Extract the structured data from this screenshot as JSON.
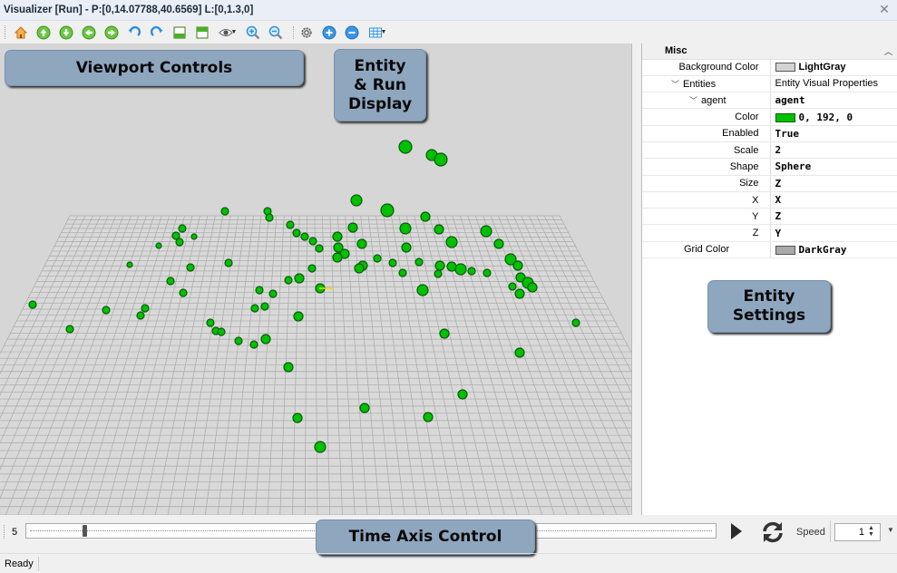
{
  "window": {
    "title": "Visualizer [Run]  - P:[0,14.07788,40.6569] L:[0,1.3,0]"
  },
  "toolbar": {
    "buttons": [
      {
        "name": "home-icon",
        "color": "#d7791a"
      },
      {
        "name": "pan-up-icon",
        "color": "#4caf2a"
      },
      {
        "name": "pan-down-icon",
        "color": "#4caf2a"
      },
      {
        "name": "pan-left-icon",
        "color": "#4caf2a"
      },
      {
        "name": "pan-right-icon",
        "color": "#4caf2a"
      },
      {
        "name": "rotate-left-icon",
        "color": "#2c8fe0"
      },
      {
        "name": "rotate-right-icon",
        "color": "#2c8fe0"
      },
      {
        "name": "view-bottom-icon",
        "color": "#4caf2a"
      },
      {
        "name": "view-top-icon",
        "color": "#4caf2a"
      },
      {
        "name": "eye-icon",
        "color": "#555555"
      },
      {
        "name": "zoom-in-icon",
        "color": "#2c8fe0"
      },
      {
        "name": "zoom-out-icon",
        "color": "#2c8fe0"
      },
      {
        "name": "settings-icon",
        "color": "#555555"
      },
      {
        "name": "add-icon",
        "color": "#2c8fe0"
      },
      {
        "name": "remove-icon",
        "color": "#2c8fe0"
      },
      {
        "name": "grid-icon",
        "color": "#2c8fe0"
      }
    ]
  },
  "callouts": {
    "viewport_controls": "Viewport Controls",
    "entity_run_display_1": "Entity",
    "entity_run_display_2": "& Run",
    "entity_run_display_3": "Display",
    "entity_settings_1": "Entity",
    "entity_settings_2": "Settings",
    "time_axis_control": "Time Axis Control"
  },
  "properties": {
    "category": "Misc",
    "background_color": {
      "name": "Background Color",
      "value": "LightGray",
      "swatch": "#d3d3d3"
    },
    "entities": {
      "name": "Entities",
      "value": "Entity Visual Properties"
    },
    "agent": {
      "name": "agent",
      "value": "agent"
    },
    "color": {
      "name": "Color",
      "value": "0, 192, 0",
      "swatch": "#00c000"
    },
    "enabled": {
      "name": "Enabled",
      "value": "True"
    },
    "scale": {
      "name": "Scale",
      "value": "2"
    },
    "shape": {
      "name": "Shape",
      "value": "Sphere"
    },
    "size": {
      "name": "Size",
      "value": "Z"
    },
    "x": {
      "name": "X",
      "value": "X"
    },
    "y": {
      "name": "Y",
      "value": "Z"
    },
    "z": {
      "name": "Z",
      "value": "Y"
    },
    "grid_color": {
      "name": "Grid Color",
      "value": "DarkGray",
      "swatch": "#a9a9a9"
    }
  },
  "timeline": {
    "frame": "5",
    "position": 0.087,
    "speed_label": "Speed",
    "speed_value": "1"
  },
  "status": {
    "text": "Ready"
  },
  "scene": {
    "background": "#d6d6d6",
    "grid_color": "#a9a9a9",
    "entity_color": "#00c000"
  }
}
